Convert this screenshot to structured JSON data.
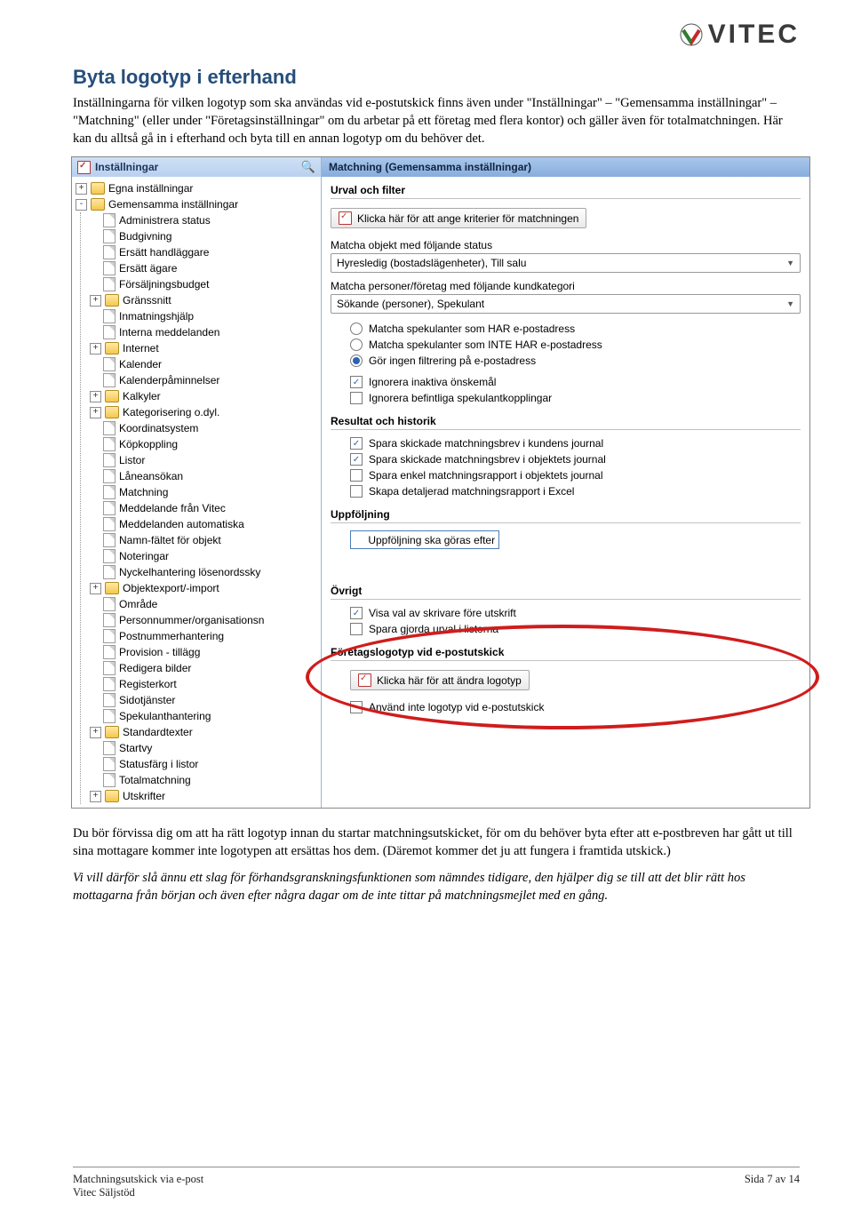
{
  "brand": {
    "name": "VITEC"
  },
  "heading": "Byta logotyp i efterhand",
  "para1": "Inställningarna för vilken logotyp som ska användas vid e-postutskick finns även under \"Inställningar\" – \"Gemensamma inställningar\" – \"Matchning\" (eller under \"Företagsinställningar\" om du arbetar på ett företag med flera kontor) och gäller även för totalmatchningen. Här kan du alltså gå in i efterhand och byta till en annan logotyp om du behöver det.",
  "shot": {
    "left": {
      "title": "Inställningar",
      "root": [
        {
          "tw": "+",
          "label": "Egna inställningar"
        },
        {
          "tw": "-",
          "label": "Gemensamma inställningar"
        }
      ],
      "items": [
        {
          "tw": "",
          "icon": "doc",
          "label": "Administrera status"
        },
        {
          "tw": "",
          "icon": "doc",
          "label": "Budgivning"
        },
        {
          "tw": "",
          "icon": "doc",
          "label": "Ersätt handläggare"
        },
        {
          "tw": "",
          "icon": "doc",
          "label": "Ersätt ägare"
        },
        {
          "tw": "",
          "icon": "doc",
          "label": "Försäljningsbudget"
        },
        {
          "tw": "+",
          "icon": "folder",
          "label": "Gränssnitt"
        },
        {
          "tw": "",
          "icon": "doc",
          "label": "Inmatningshjälp"
        },
        {
          "tw": "",
          "icon": "doc",
          "label": "Interna meddelanden"
        },
        {
          "tw": "+",
          "icon": "folder",
          "label": "Internet"
        },
        {
          "tw": "",
          "icon": "doc",
          "label": "Kalender"
        },
        {
          "tw": "",
          "icon": "doc",
          "label": "Kalenderpåminnelser"
        },
        {
          "tw": "+",
          "icon": "folder",
          "label": "Kalkyler"
        },
        {
          "tw": "+",
          "icon": "folder",
          "label": "Kategorisering o.dyl."
        },
        {
          "tw": "",
          "icon": "doc",
          "label": "Koordinatsystem"
        },
        {
          "tw": "",
          "icon": "doc",
          "label": "Köpkoppling"
        },
        {
          "tw": "",
          "icon": "doc",
          "label": "Listor"
        },
        {
          "tw": "",
          "icon": "doc",
          "label": "Låneansökan"
        },
        {
          "tw": "",
          "icon": "doc",
          "label": "Matchning"
        },
        {
          "tw": "",
          "icon": "doc",
          "label": "Meddelande från Vitec"
        },
        {
          "tw": "",
          "icon": "doc",
          "label": "Meddelanden automatiska"
        },
        {
          "tw": "",
          "icon": "doc",
          "label": "Namn-fältet för objekt"
        },
        {
          "tw": "",
          "icon": "doc",
          "label": "Noteringar"
        },
        {
          "tw": "",
          "icon": "doc",
          "label": "Nyckelhantering lösenordssky"
        },
        {
          "tw": "+",
          "icon": "folder",
          "label": "Objektexport/-import"
        },
        {
          "tw": "",
          "icon": "doc",
          "label": "Område"
        },
        {
          "tw": "",
          "icon": "doc",
          "label": "Personnummer/organisationsn"
        },
        {
          "tw": "",
          "icon": "doc",
          "label": "Postnummerhantering"
        },
        {
          "tw": "",
          "icon": "doc",
          "label": "Provision - tillägg"
        },
        {
          "tw": "",
          "icon": "doc",
          "label": "Redigera bilder"
        },
        {
          "tw": "",
          "icon": "doc",
          "label": "Registerkort"
        },
        {
          "tw": "",
          "icon": "doc",
          "label": "Sidotjänster"
        },
        {
          "tw": "",
          "icon": "doc",
          "label": "Spekulanthantering"
        },
        {
          "tw": "+",
          "icon": "folder",
          "label": "Standardtexter"
        },
        {
          "tw": "",
          "icon": "doc",
          "label": "Startvy"
        },
        {
          "tw": "",
          "icon": "doc",
          "label": "Statusfärg i listor"
        },
        {
          "tw": "",
          "icon": "doc",
          "label": "Totalmatchning"
        },
        {
          "tw": "+",
          "icon": "folder",
          "label": "Utskrifter"
        }
      ]
    },
    "right": {
      "header": "Matchning (Gemensamma inställningar)",
      "sec1_title": "Urval och filter",
      "btn_criteria": "Klicka här för att ange kriterier för matchningen",
      "status_label": "Matcha objekt med följande status",
      "status_value": "Hyresledig (bostadslägenheter), Till salu",
      "cat_label": "Matcha personer/företag med följande kundkategori",
      "cat_value": "Sökande (personer), Spekulant",
      "radio1": "Matcha spekulanter som HAR e-postadress",
      "radio2": "Matcha spekulanter som INTE HAR e-postadress",
      "radio3": "Gör ingen filtrering på e-postadress",
      "chk_ignore_inactive": "Ignorera inaktiva önskemål",
      "chk_ignore_existing": "Ignorera befintliga spekulantkopplingar",
      "sec2_title": "Resultat och historik",
      "r1": "Spara skickade matchningsbrev i kundens journal",
      "r2": "Spara skickade matchningsbrev i objektets journal",
      "r3": "Spara enkel matchningsrapport i objektets journal",
      "r4": "Skapa detaljerad matchningsrapport i Excel",
      "sec3_title": "Uppföljning",
      "followup": "Uppföljning ska göras efter",
      "sec4_title": "Övrigt",
      "o1": "Visa val av skrivare före utskrift",
      "o2": "Spara gjorda urval i listorna",
      "sec5_title": "Företagslogotyp vid e-postutskick",
      "btn_logo": "Klicka här för att ändra logotyp",
      "no_logo": "Använd inte logotyp vid e-postutskick"
    }
  },
  "para2": "Du bör förvissa dig om att ha rätt logotyp innan du startar matchningsutskicket, för om du behöver byta efter att e-postbreven har gått ut till sina mottagare kommer inte logotypen att ersättas hos dem. (Däremot kommer det ju att fungera i framtida utskick.)",
  "para3": "Vi vill därför slå ännu ett slag för förhandsgranskningsfunktionen som nämndes tidigare, den hjälper dig se till att det blir rätt hos mottagarna från början och även efter några dagar om de inte tittar på matchningsmejlet med en gång.",
  "footer": {
    "left_l1": "Matchningsutskick via e-post",
    "left_l2": "Vitec Säljstöd",
    "right": "Sida 7 av 14"
  }
}
